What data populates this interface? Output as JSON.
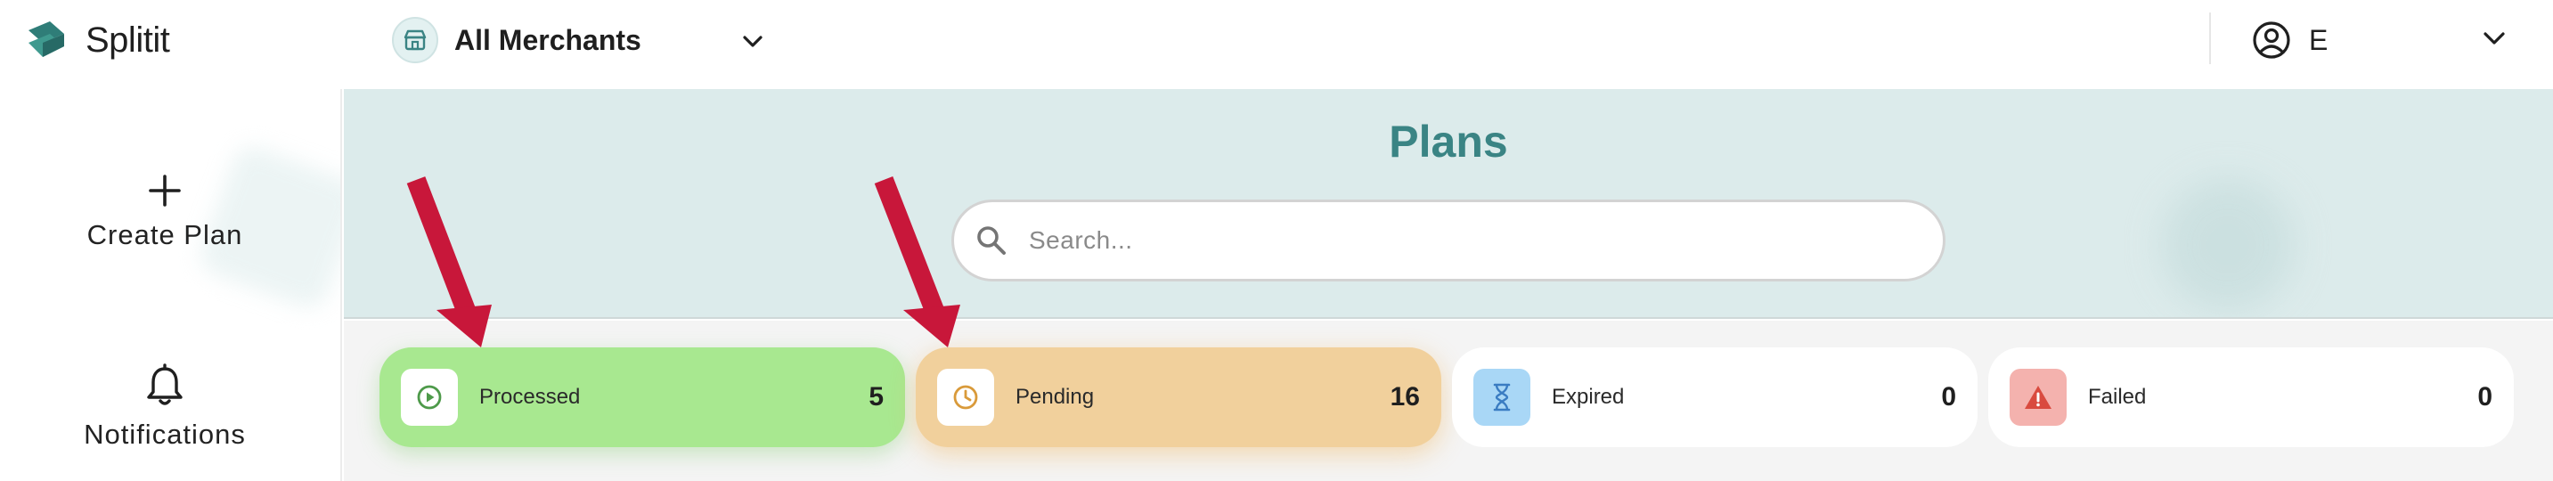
{
  "header": {
    "brand": "Splitit",
    "merchant_selector": {
      "selected": "All Merchants"
    },
    "user": {
      "initial": "E"
    }
  },
  "sidebar": {
    "items": [
      {
        "label": "Create Plan",
        "icon": "plus-icon"
      },
      {
        "label": "Notifications",
        "icon": "bell-icon"
      }
    ]
  },
  "main": {
    "title": "Plans",
    "search": {
      "placeholder": "Search...",
      "value": ""
    },
    "status_cards": [
      {
        "label": "Processed",
        "count": "5",
        "icon": "play-circle-icon",
        "color": "#a8e890"
      },
      {
        "label": "Pending",
        "count": "16",
        "icon": "clock-icon",
        "color": "#f1d09c"
      },
      {
        "label": "Expired",
        "count": "0",
        "icon": "hourglass-icon",
        "color": "#a9d7f6"
      },
      {
        "label": "Failed",
        "count": "0",
        "icon": "warning-icon",
        "color": "#f4b2ae"
      }
    ]
  },
  "colors": {
    "accent": "#3a8484",
    "banner_bg": "#dcebeb",
    "annotation_arrow": "#c8173a"
  }
}
